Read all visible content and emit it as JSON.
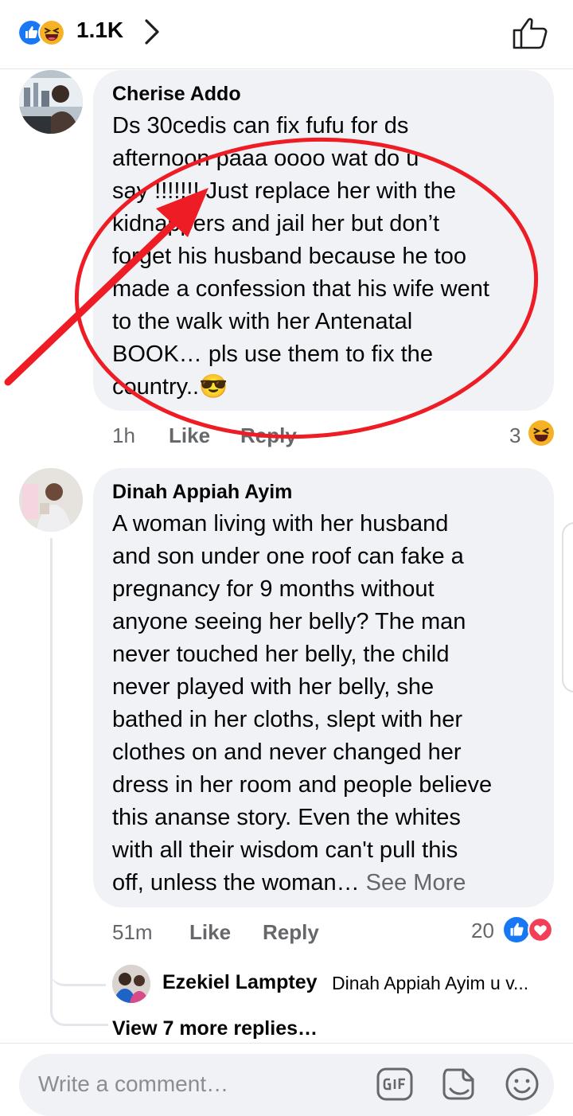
{
  "header": {
    "reaction_count": "1.1K",
    "reaction_icons": [
      "like-reaction-icon",
      "haha-reaction-icon"
    ]
  },
  "comments": [
    {
      "author": "Cherise Addo",
      "text": "Ds 30cedis can fix fufu for ds\nafternoon paaa oooo wat do u\nsay !!!!!!! Just replace her with the\nkidnappers and jail her but don’t\nforget his husband because he too\nmade a confession that his wife went\nto the walk with her Antenatal\nBOOK… pls use them to fix the\ncountry..😎",
      "time": "1h",
      "like_label": "Like",
      "reply_label": "Reply",
      "reaction_count": "3"
    },
    {
      "author": "Dinah Appiah Ayim",
      "text": "A woman living with her husband\nand son under one roof can fake a\npregnancy for 9 months without\nanyone seeing her belly? The man\nnever touched her belly, the child\nnever played with her belly, she\nbathed in her cloths, slept with her\nclothes on and never changed her\ndress in her room and people believe\nthis ananse story. Even the whites\nwith all their wisdom can't pull this\noff, unless the woman… ",
      "see_more": "See More",
      "time": "51m",
      "like_label": "Like",
      "reply_label": "Reply",
      "reaction_count": "20",
      "reply": {
        "author": "Ezekiel Lamptey",
        "preview": "Dinah Appiah Ayim u v..."
      },
      "view_more_replies": "View 7 more replies…"
    }
  ],
  "composer": {
    "placeholder": "Write a comment…",
    "icons": [
      "gif-icon",
      "sticker-icon",
      "emoji-icon"
    ]
  },
  "colors": {
    "like_blue": "#1877f2",
    "love_red": "#f33e58",
    "haha_yellow": "#f7b125",
    "annotation_red": "#ee1c24",
    "meta_gray": "#65676b",
    "bubble_gray": "#f0f2f5"
  }
}
